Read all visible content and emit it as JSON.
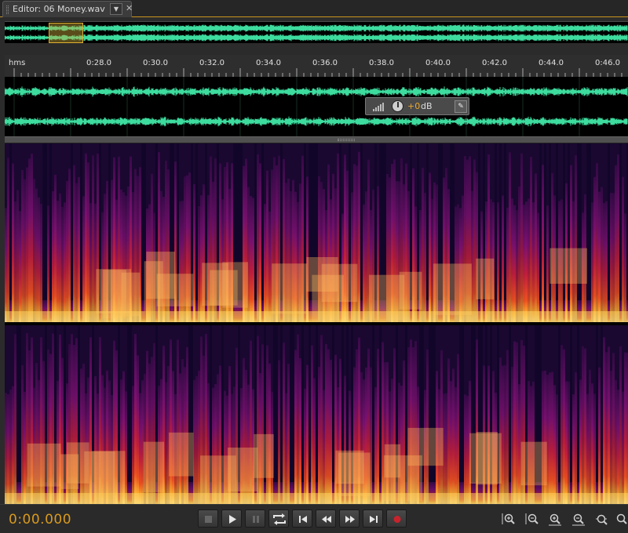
{
  "editor_tab": {
    "title": "Editor: 06 Money.wav",
    "menu_icon": "chevron-down-icon",
    "close_icon": "close-icon"
  },
  "ruler": {
    "units": "hms",
    "labels": [
      "0:28.0",
      "0:30.0",
      "0:32.0",
      "0:34.0",
      "0:36.0",
      "0:38.0",
      "0:40.0",
      "0:42.0",
      "0:44.0",
      "0:46.0"
    ]
  },
  "volume_hud": {
    "value": "+0",
    "unit": "dB",
    "meter_icon": "level-meter-icon",
    "knob_icon": "volume-knob-icon",
    "pin_icon": "pin-icon"
  },
  "time_display": "0:00.000",
  "transport": [
    {
      "name": "stop-button",
      "icon": "stop-icon",
      "enabled": false
    },
    {
      "name": "play-button",
      "icon": "play-icon",
      "enabled": true
    },
    {
      "name": "pause-button",
      "icon": "pause-icon",
      "enabled": false
    },
    {
      "name": "loop-playback-button",
      "icon": "loop-icon",
      "enabled": true
    },
    {
      "name": "go-to-start-button",
      "icon": "skip-to-start-icon",
      "enabled": true
    },
    {
      "name": "rewind-button",
      "icon": "rewind-icon",
      "enabled": true
    },
    {
      "name": "fast-forward-button",
      "icon": "fast-forward-icon",
      "enabled": true
    },
    {
      "name": "go-to-end-button",
      "icon": "skip-to-end-icon",
      "enabled": true
    },
    {
      "name": "record-button",
      "icon": "record-icon",
      "enabled": true
    }
  ],
  "zoom_tools": [
    {
      "name": "zoom-in-amplitude-button",
      "icon": "zoom-in-amplitude-icon"
    },
    {
      "name": "zoom-out-amplitude-button",
      "icon": "zoom-out-amplitude-icon"
    },
    {
      "name": "zoom-in-time-button",
      "icon": "zoom-in-time-icon"
    },
    {
      "name": "zoom-out-time-button",
      "icon": "zoom-out-time-icon"
    },
    {
      "name": "zoom-selection-button",
      "icon": "zoom-selection-icon"
    },
    {
      "name": "zoom-full-button",
      "icon": "zoom-full-icon"
    }
  ],
  "colors": {
    "waveform": "#3ddc9e",
    "accent": "#d99a1e",
    "record": "#c8232c",
    "selection": "#e0b030"
  }
}
